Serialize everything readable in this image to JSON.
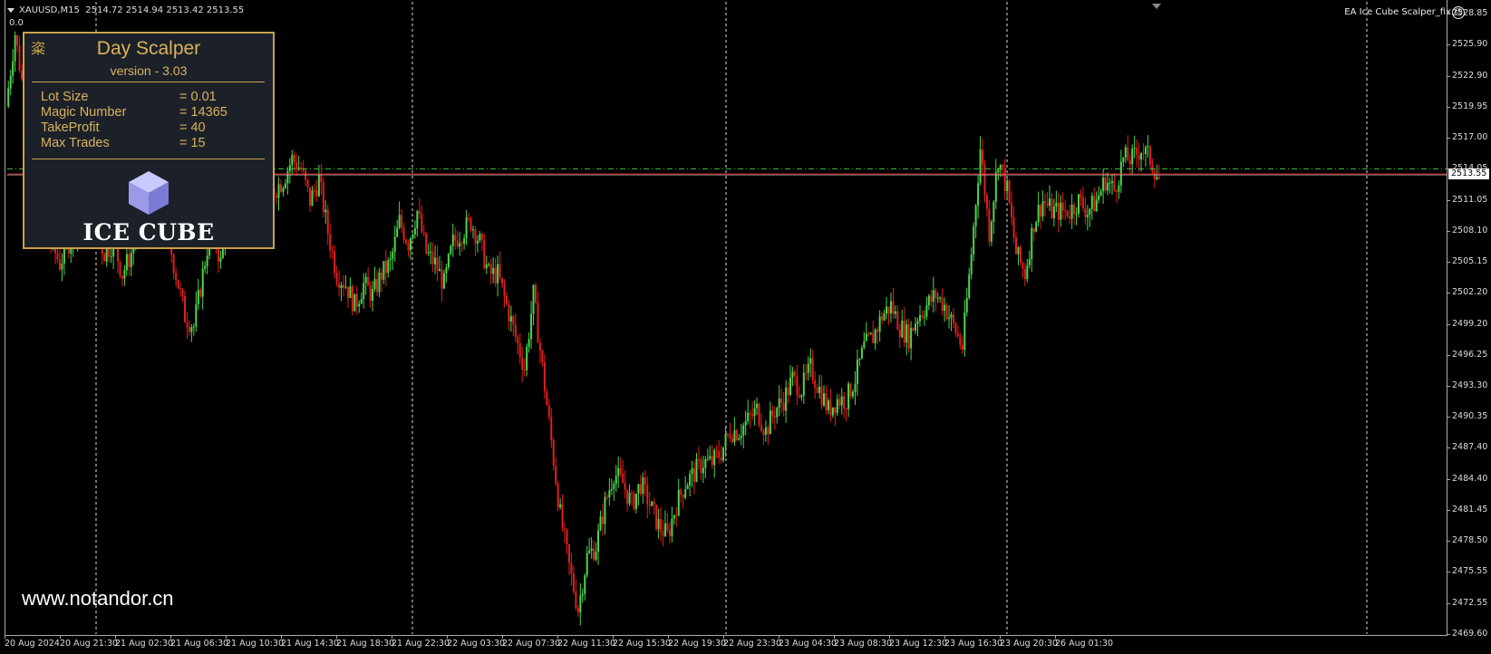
{
  "header": {
    "symbol_info": "XAUUSD,M15  2514.72 2514.94 2513.42 2513.55",
    "indicator_value": "0.0",
    "ea_name": "EA Ice Cube Scalper_fix",
    "smiley_icon": "smiley-icon"
  },
  "panel": {
    "logo_glyph": "粢",
    "title": "Day Scalper",
    "version": "version - 3.03",
    "rows": [
      {
        "label": "Lot Size",
        "value": "= 0.01"
      },
      {
        "label": "Magic Number",
        "value": "= 14365"
      },
      {
        "label": "TakeProfit",
        "value": "= 40"
      },
      {
        "label": "Max Trades",
        "value": "= 15"
      }
    ],
    "brand": "ICE CUBE",
    "cube_icon": "cube-icon"
  },
  "watermark": "www.notandor.cn",
  "price_axis": {
    "labels": [
      "2528.85",
      "2525.90",
      "2522.90",
      "2519.95",
      "2517.00",
      "2514.05",
      "2511.05",
      "2508.10",
      "2505.15",
      "2502.20",
      "2499.20",
      "2496.25",
      "2493.30",
      "2490.35",
      "2487.40",
      "2484.40",
      "2481.45",
      "2478.50",
      "2475.55",
      "2472.55",
      "2469.60"
    ],
    "current_price": "2513.55"
  },
  "time_axis": {
    "labels": [
      "20 Aug 2024",
      "20 Aug 21:30",
      "21 Aug 02:30",
      "21 Aug 06:30",
      "21 Aug 10:30",
      "21 Aug 14:30",
      "21 Aug 18:30",
      "21 Aug 22:30",
      "22 Aug 03:30",
      "22 Aug 07:30",
      "22 Aug 11:30",
      "22 Aug 15:30",
      "22 Aug 19:30",
      "22 Aug 23:30",
      "23 Aug 04:30",
      "23 Aug 08:30",
      "23 Aug 12:30",
      "23 Aug 16:30",
      "23 Aug 20:30",
      "26 Aug 01:30"
    ]
  },
  "colors": {
    "background": "#000000",
    "bull_candle": "#4cd64c",
    "bear_candle": "#e0201e",
    "bid_line": "#e0201e",
    "ask_line": "#3fbf3f",
    "panel_border": "#c9a24b",
    "panel_text": "#d9b25b",
    "panel_bg": "#1c2129"
  },
  "chart_data": {
    "type": "candlestick",
    "symbol": "XAUUSD",
    "timeframe": "M15",
    "ylim": [
      2469.6,
      2530.0
    ],
    "bid": 2513.55,
    "ask": 2514.05,
    "path": [
      [
        0,
        2520
      ],
      [
        1,
        2527
      ],
      [
        2,
        2521
      ],
      [
        3,
        2518
      ],
      [
        4,
        2513
      ],
      [
        5,
        2507
      ],
      [
        6,
        2505
      ],
      [
        7,
        2507
      ],
      [
        8,
        2509
      ],
      [
        9,
        2512
      ],
      [
        10,
        2508
      ],
      [
        11,
        2506
      ],
      [
        12,
        2507
      ],
      [
        13,
        2504
      ],
      [
        14,
        2506
      ],
      [
        15,
        2511
      ],
      [
        16,
        2513
      ],
      [
        17,
        2512
      ],
      [
        18,
        2508
      ],
      [
        19,
        2504
      ],
      [
        20,
        2500
      ],
      [
        21,
        2499
      ],
      [
        22,
        2504
      ],
      [
        23,
        2509
      ],
      [
        24,
        2505
      ],
      [
        25,
        2512
      ],
      [
        26,
        2517
      ],
      [
        27,
        2513
      ],
      [
        28,
        2514
      ],
      [
        29,
        2511
      ],
      [
        30,
        2512
      ],
      [
        31,
        2513
      ],
      [
        32,
        2515
      ],
      [
        33,
        2514
      ],
      [
        34,
        2511
      ],
      [
        35,
        2513
      ],
      [
        36,
        2508
      ],
      [
        37,
        2504
      ],
      [
        38,
        2503
      ],
      [
        39,
        2501
      ],
      [
        40,
        2503
      ],
      [
        41,
        2502
      ],
      [
        42,
        2504
      ],
      [
        43,
        2505
      ],
      [
        44,
        2509
      ],
      [
        45,
        2507
      ],
      [
        46,
        2510
      ],
      [
        47,
        2506
      ],
      [
        48,
        2505
      ],
      [
        49,
        2503
      ],
      [
        50,
        2507
      ],
      [
        51,
        2508
      ],
      [
        52,
        2509
      ],
      [
        53,
        2507
      ],
      [
        54,
        2504
      ],
      [
        55,
        2504
      ],
      [
        56,
        2501
      ],
      [
        57,
        2498
      ],
      [
        58,
        2495
      ],
      [
        59,
        2502
      ],
      [
        60,
        2495
      ],
      [
        61,
        2488
      ],
      [
        62,
        2481
      ],
      [
        63,
        2476
      ],
      [
        64,
        2472
      ],
      [
        65,
        2477
      ],
      [
        66,
        2478
      ],
      [
        67,
        2482
      ],
      [
        68,
        2485
      ],
      [
        69,
        2484
      ],
      [
        70,
        2482
      ],
      [
        71,
        2484
      ],
      [
        72,
        2482
      ],
      [
        73,
        2480
      ],
      [
        74,
        2479
      ],
      [
        75,
        2482
      ],
      [
        76,
        2484
      ],
      [
        77,
        2485
      ],
      [
        78,
        2486
      ],
      [
        79,
        2486
      ],
      [
        80,
        2487
      ],
      [
        81,
        2489
      ],
      [
        82,
        2489
      ],
      [
        83,
        2490
      ],
      [
        84,
        2491
      ],
      [
        85,
        2489
      ],
      [
        86,
        2491
      ],
      [
        87,
        2492
      ],
      [
        88,
        2494
      ],
      [
        89,
        2493
      ],
      [
        90,
        2495
      ],
      [
        91,
        2493
      ],
      [
        92,
        2491
      ],
      [
        93,
        2492
      ],
      [
        94,
        2492
      ],
      [
        95,
        2494
      ],
      [
        96,
        2497
      ],
      [
        97,
        2498
      ],
      [
        98,
        2500
      ],
      [
        99,
        2501
      ],
      [
        100,
        2499
      ],
      [
        101,
        2498
      ],
      [
        102,
        2500
      ],
      [
        103,
        2501
      ],
      [
        104,
        2502
      ],
      [
        105,
        2501
      ],
      [
        106,
        2499
      ],
      [
        107,
        2497
      ],
      [
        108,
        2506
      ],
      [
        109,
        2516
      ],
      [
        110,
        2508
      ],
      [
        111,
        2515
      ],
      [
        112,
        2512
      ],
      [
        113,
        2506
      ],
      [
        114,
        2504
      ],
      [
        115,
        2509
      ],
      [
        116,
        2511
      ],
      [
        117,
        2510
      ],
      [
        118,
        2510
      ],
      [
        119,
        2510
      ],
      [
        120,
        2511
      ],
      [
        121,
        2510
      ],
      [
        122,
        2511
      ],
      [
        123,
        2513
      ],
      [
        124,
        2512
      ],
      [
        125,
        2515
      ],
      [
        126,
        2515
      ],
      [
        127,
        2516
      ],
      [
        128,
        2515
      ],
      [
        129,
        2513
      ]
    ],
    "grid_separators": [
      "20 Aug 21:30",
      "22 Aug 03:30",
      "22 Aug 23:30",
      "23 Aug 20:30"
    ],
    "grid": "vertical day separators (dotted)"
  }
}
